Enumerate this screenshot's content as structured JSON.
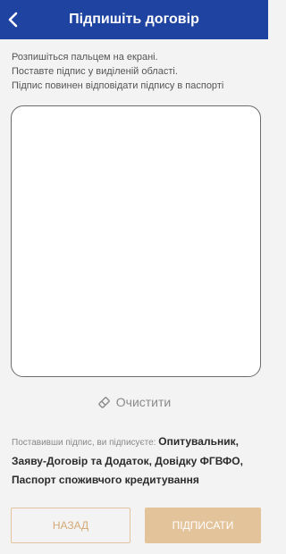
{
  "header": {
    "title": "Підпишіть договір",
    "back_icon": "chevron-left-icon",
    "background": "#1e43a0"
  },
  "instructions": [
    "Розпишіться пальцем на екрані.",
    "Поставте підпис у виділеній області.",
    "Підпис повинен відповідати підпису в паспорті"
  ],
  "clear": {
    "label": "Очистити",
    "icon": "eraser-icon"
  },
  "legal": {
    "lead": "Поставивши підпис, ви підписуєте: ",
    "documents": "Опитувальник, Заяву-Договір та Додаток, Довідку ФГВФО, Паспорт споживчого кредитування"
  },
  "buttons": {
    "back": "НАЗАД",
    "sign": "ПІДПИСАТИ"
  },
  "colors": {
    "accent": "#1e43a0",
    "gold": "#e3c39a"
  }
}
